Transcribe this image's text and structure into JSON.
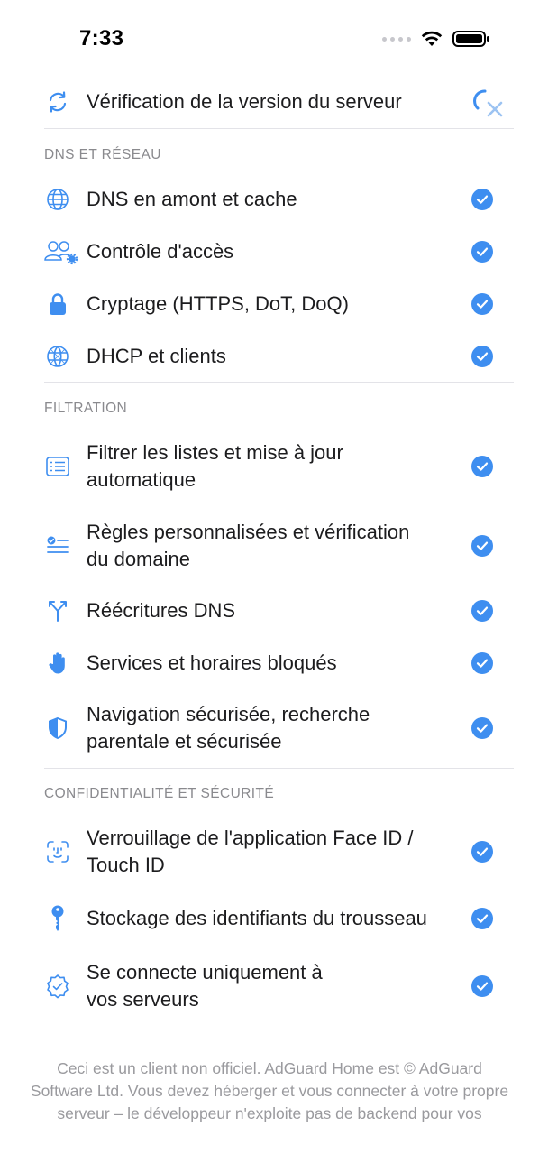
{
  "status_bar": {
    "time": "7:33"
  },
  "top_row": {
    "label": "Vérification de la version du serveur",
    "icon": "refresh-icon"
  },
  "sections": {
    "dns": {
      "title": "DNS ET RÉSEAU",
      "items": [
        {
          "label": "DNS en amont et cache",
          "icon": "globe-icon",
          "checked": true
        },
        {
          "label": "Contrôle d'accès",
          "icon": "users-gear-icon",
          "checked": true
        },
        {
          "label": "Cryptage (HTTPS, DoT, DoQ)",
          "icon": "lock-icon",
          "checked": true
        },
        {
          "label": "DHCP et clients",
          "icon": "network-globe-icon",
          "checked": true
        }
      ]
    },
    "filtration": {
      "title": "FILTRATION",
      "items": [
        {
          "label_line1": "Filtrer les listes et mise à jour",
          "label_line2": "automatique",
          "icon": "list-icon",
          "checked": true
        },
        {
          "label_line1": "Règles personnalisées et vérification",
          "label_line2": "du domaine",
          "icon": "rules-check-icon",
          "checked": true
        },
        {
          "label": "Réécritures DNS",
          "icon": "fork-icon",
          "checked": true
        },
        {
          "label": "Services et horaires bloqués",
          "icon": "hand-icon",
          "checked": true
        },
        {
          "label_line1": "Navigation sécurisée, recherche",
          "label_line2": "parentale et sécurisée",
          "icon": "shield-icon",
          "checked": true
        }
      ]
    },
    "privacy": {
      "title": "CONFIDENTIALITÉ ET SÉCURITÉ",
      "items": [
        {
          "label_line1": "Verrouillage de l'application Face ID /",
          "label_line2": "Touch ID",
          "icon": "faceid-icon",
          "checked": true
        },
        {
          "label": "Stockage des identifiants du trousseau",
          "icon": "key-icon",
          "checked": true
        },
        {
          "label_line1": "Se connecte uniquement à",
          "label_line2": "vos serveurs",
          "icon": "verified-badge-icon",
          "checked": true
        }
      ]
    }
  },
  "footer": {
    "text": "Ceci est un client non officiel. AdGuard Home est © AdGuard Software Ltd. Vous devez héberger et vous connecter à votre propre serveur – le développeur n'exploite pas de backend pour vos données."
  },
  "colors": {
    "accent": "#3e8ef0",
    "text": "#1c1c1e",
    "secondary": "#8a8a8e",
    "divider": "#e3e3e8"
  }
}
